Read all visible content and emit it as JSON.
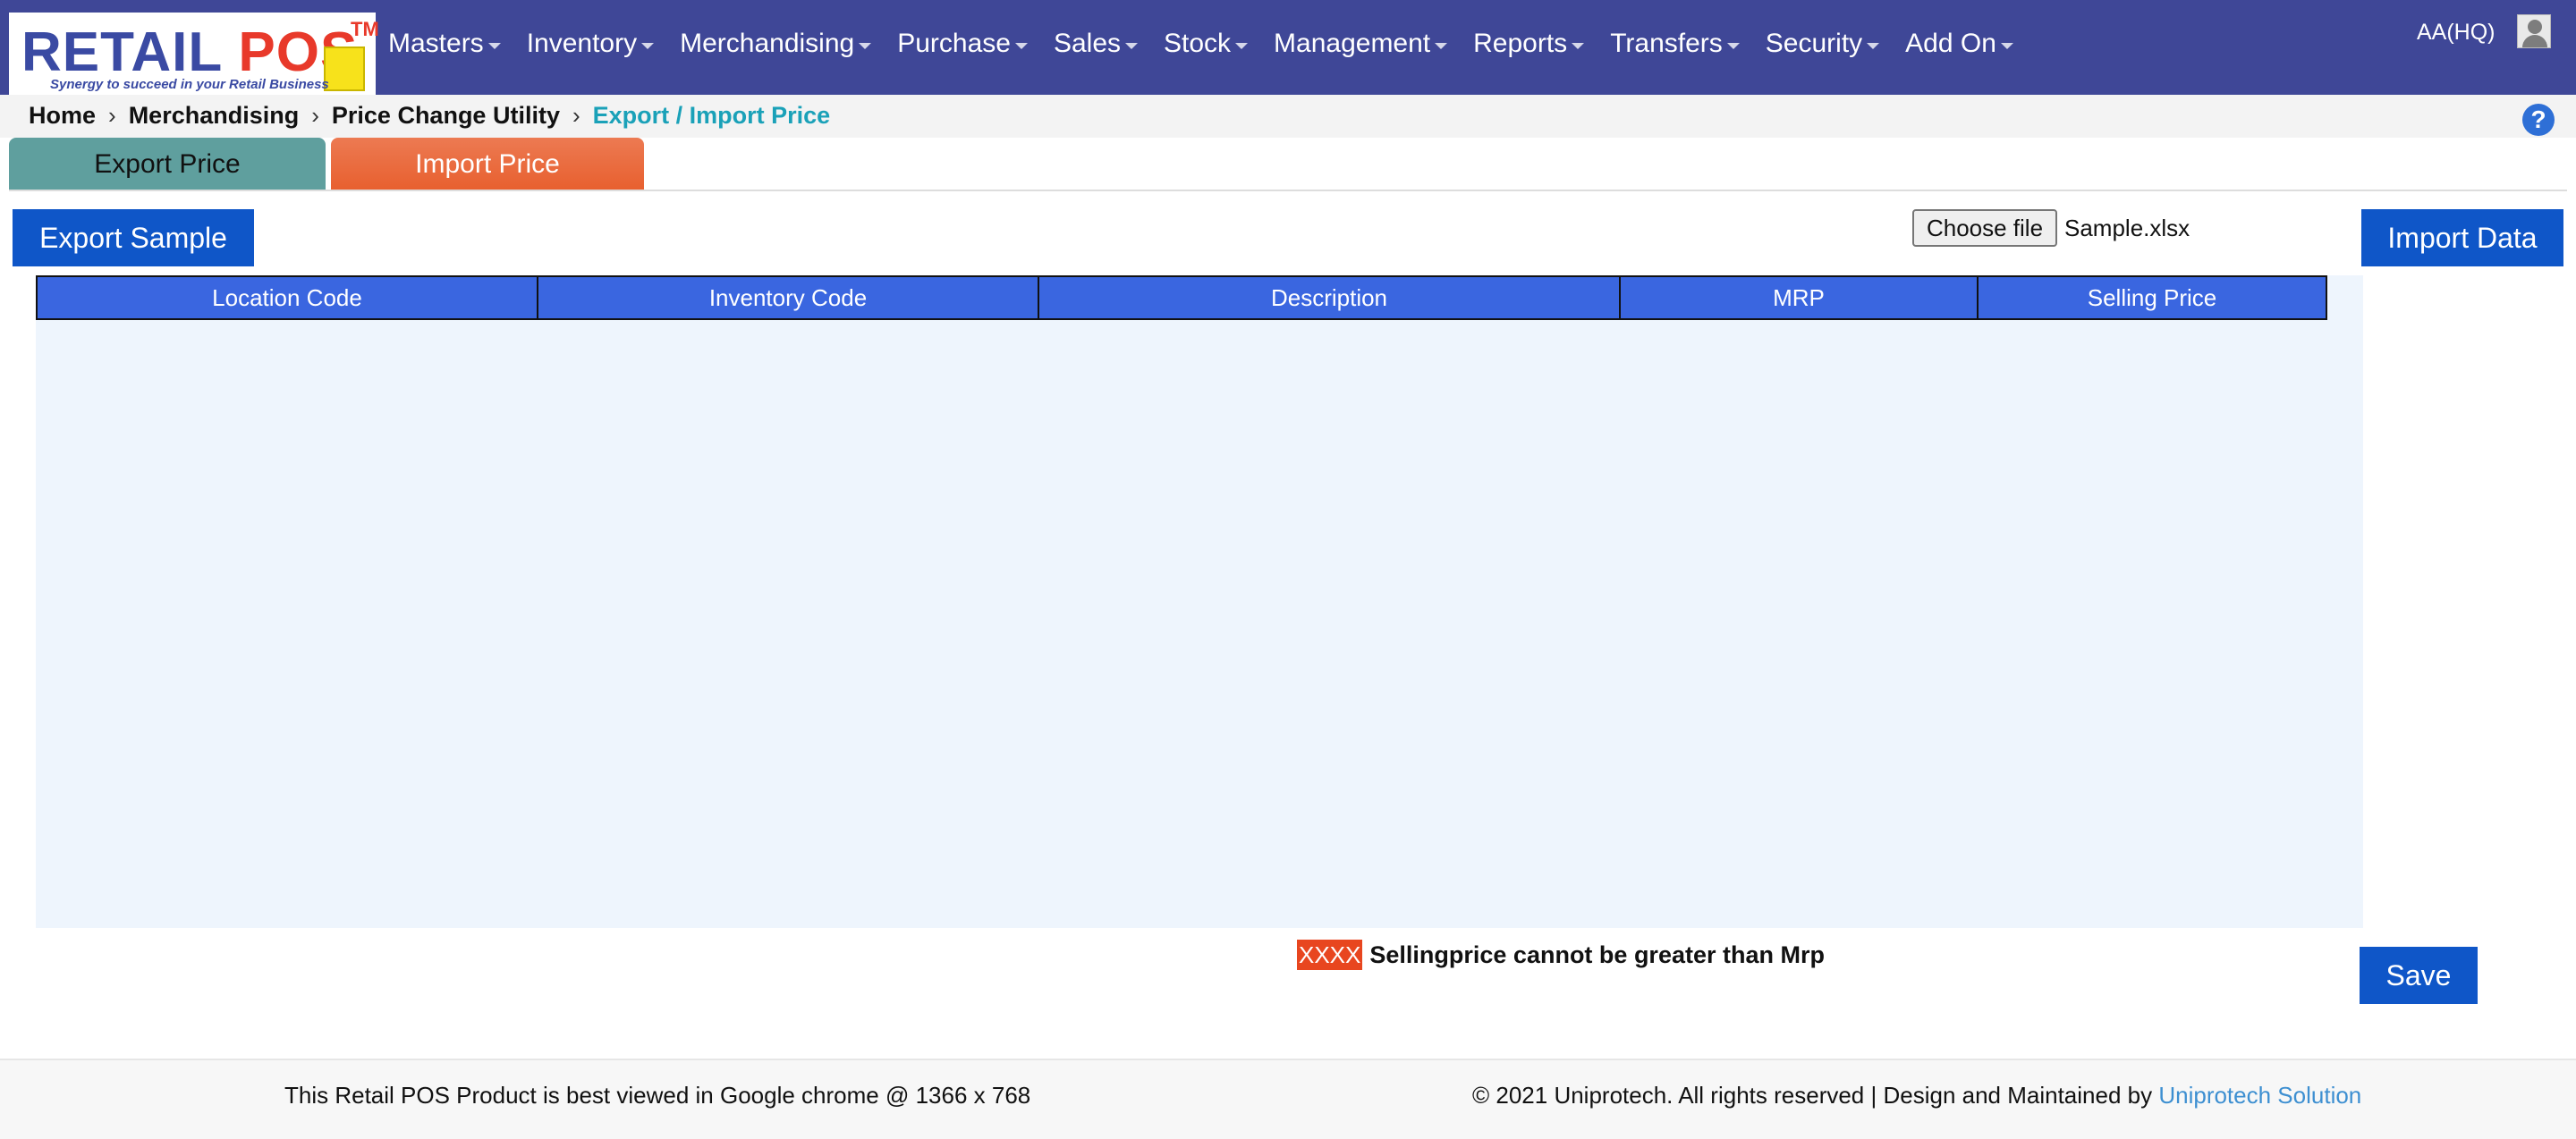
{
  "logo": {
    "part1": "RETAIL",
    "part2": "POS",
    "tm": "TM",
    "tagline": "Synergy to succeed in your Retail Business"
  },
  "nav": {
    "items": [
      {
        "label": "Masters"
      },
      {
        "label": "Inventory"
      },
      {
        "label": "Merchandising"
      },
      {
        "label": "Purchase"
      },
      {
        "label": "Sales"
      },
      {
        "label": "Stock"
      },
      {
        "label": "Management"
      },
      {
        "label": "Reports"
      },
      {
        "label": "Transfers"
      },
      {
        "label": "Security"
      },
      {
        "label": "Add On"
      }
    ],
    "user": "AA(HQ)",
    "user_icon": "user-avatar-icon"
  },
  "breadcrumb": {
    "items": [
      "Home",
      "Merchandising",
      "Price Change Utility"
    ],
    "current": "Export / Import Price",
    "separator": "›"
  },
  "help": {
    "icon": "help-icon",
    "glyph": "?"
  },
  "tabs": {
    "export": "Export Price",
    "import": "Import Price",
    "active": "import"
  },
  "toolbar": {
    "export_sample": "Export Sample",
    "choose_file": "Choose file",
    "file_name": "Sample.xlsx",
    "import_data": "Import Data"
  },
  "table": {
    "columns": [
      "Location Code",
      "Inventory Code",
      "Description",
      "MRP",
      "Selling Price"
    ],
    "rows": []
  },
  "legend": {
    "swatch_text": "XXXX",
    "text": "Sellingprice cannot be greater than Mrp"
  },
  "actions": {
    "save": "Save"
  },
  "footer": {
    "left": "This Retail POS Product is best viewed in Google chrome @ 1366 x 768",
    "right": "© 2021 Uniprotech. All rights reserved | Design and Maintained by",
    "link": "Uniprotech Solution"
  },
  "colors": {
    "navbar": "#3f4797",
    "primary_button": "#0f56c8",
    "table_header": "#3a66e0",
    "export_tab": "#5f9f9e",
    "import_tab": "#e85f2e",
    "error_swatch": "#e8461f",
    "breadcrumb_active": "#1aa1b8"
  }
}
